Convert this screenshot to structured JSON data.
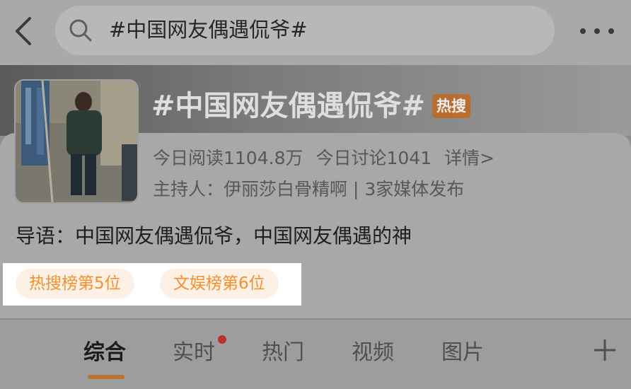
{
  "search": {
    "query": "#中国网友偶遇侃爷#"
  },
  "topic": {
    "title": "#中国网友偶遇侃爷#",
    "hot_badge": "热搜",
    "reads": "今日阅读1104.8万",
    "discussions": "今日讨论1041",
    "details_link": "详情>",
    "host": "主持人：伊丽莎白骨精啊 | 3家媒体发布",
    "intro": "导语：中国网友偶遇侃爷，中国网友偶遇的神",
    "tags": [
      "热搜榜第5位",
      "文娱榜第6位"
    ]
  },
  "tabs": [
    {
      "label": "综合",
      "active": true
    },
    {
      "label": "实时",
      "active": false,
      "has_dot": true
    },
    {
      "label": "热门",
      "active": false
    },
    {
      "label": "视频",
      "active": false
    },
    {
      "label": "图片",
      "active": false
    }
  ],
  "icons": {
    "back": "chevron-left-icon",
    "search": "search-icon",
    "more": "more-horizontal-icon",
    "add_tab": "plus-icon"
  },
  "colors": {
    "accent_orange": "#f2902f",
    "tag_bg": "#fdf0e4",
    "hot_badge_bg": "#b96d2f",
    "tab_underline": "#b8742f",
    "red_dot": "#b8312c"
  }
}
